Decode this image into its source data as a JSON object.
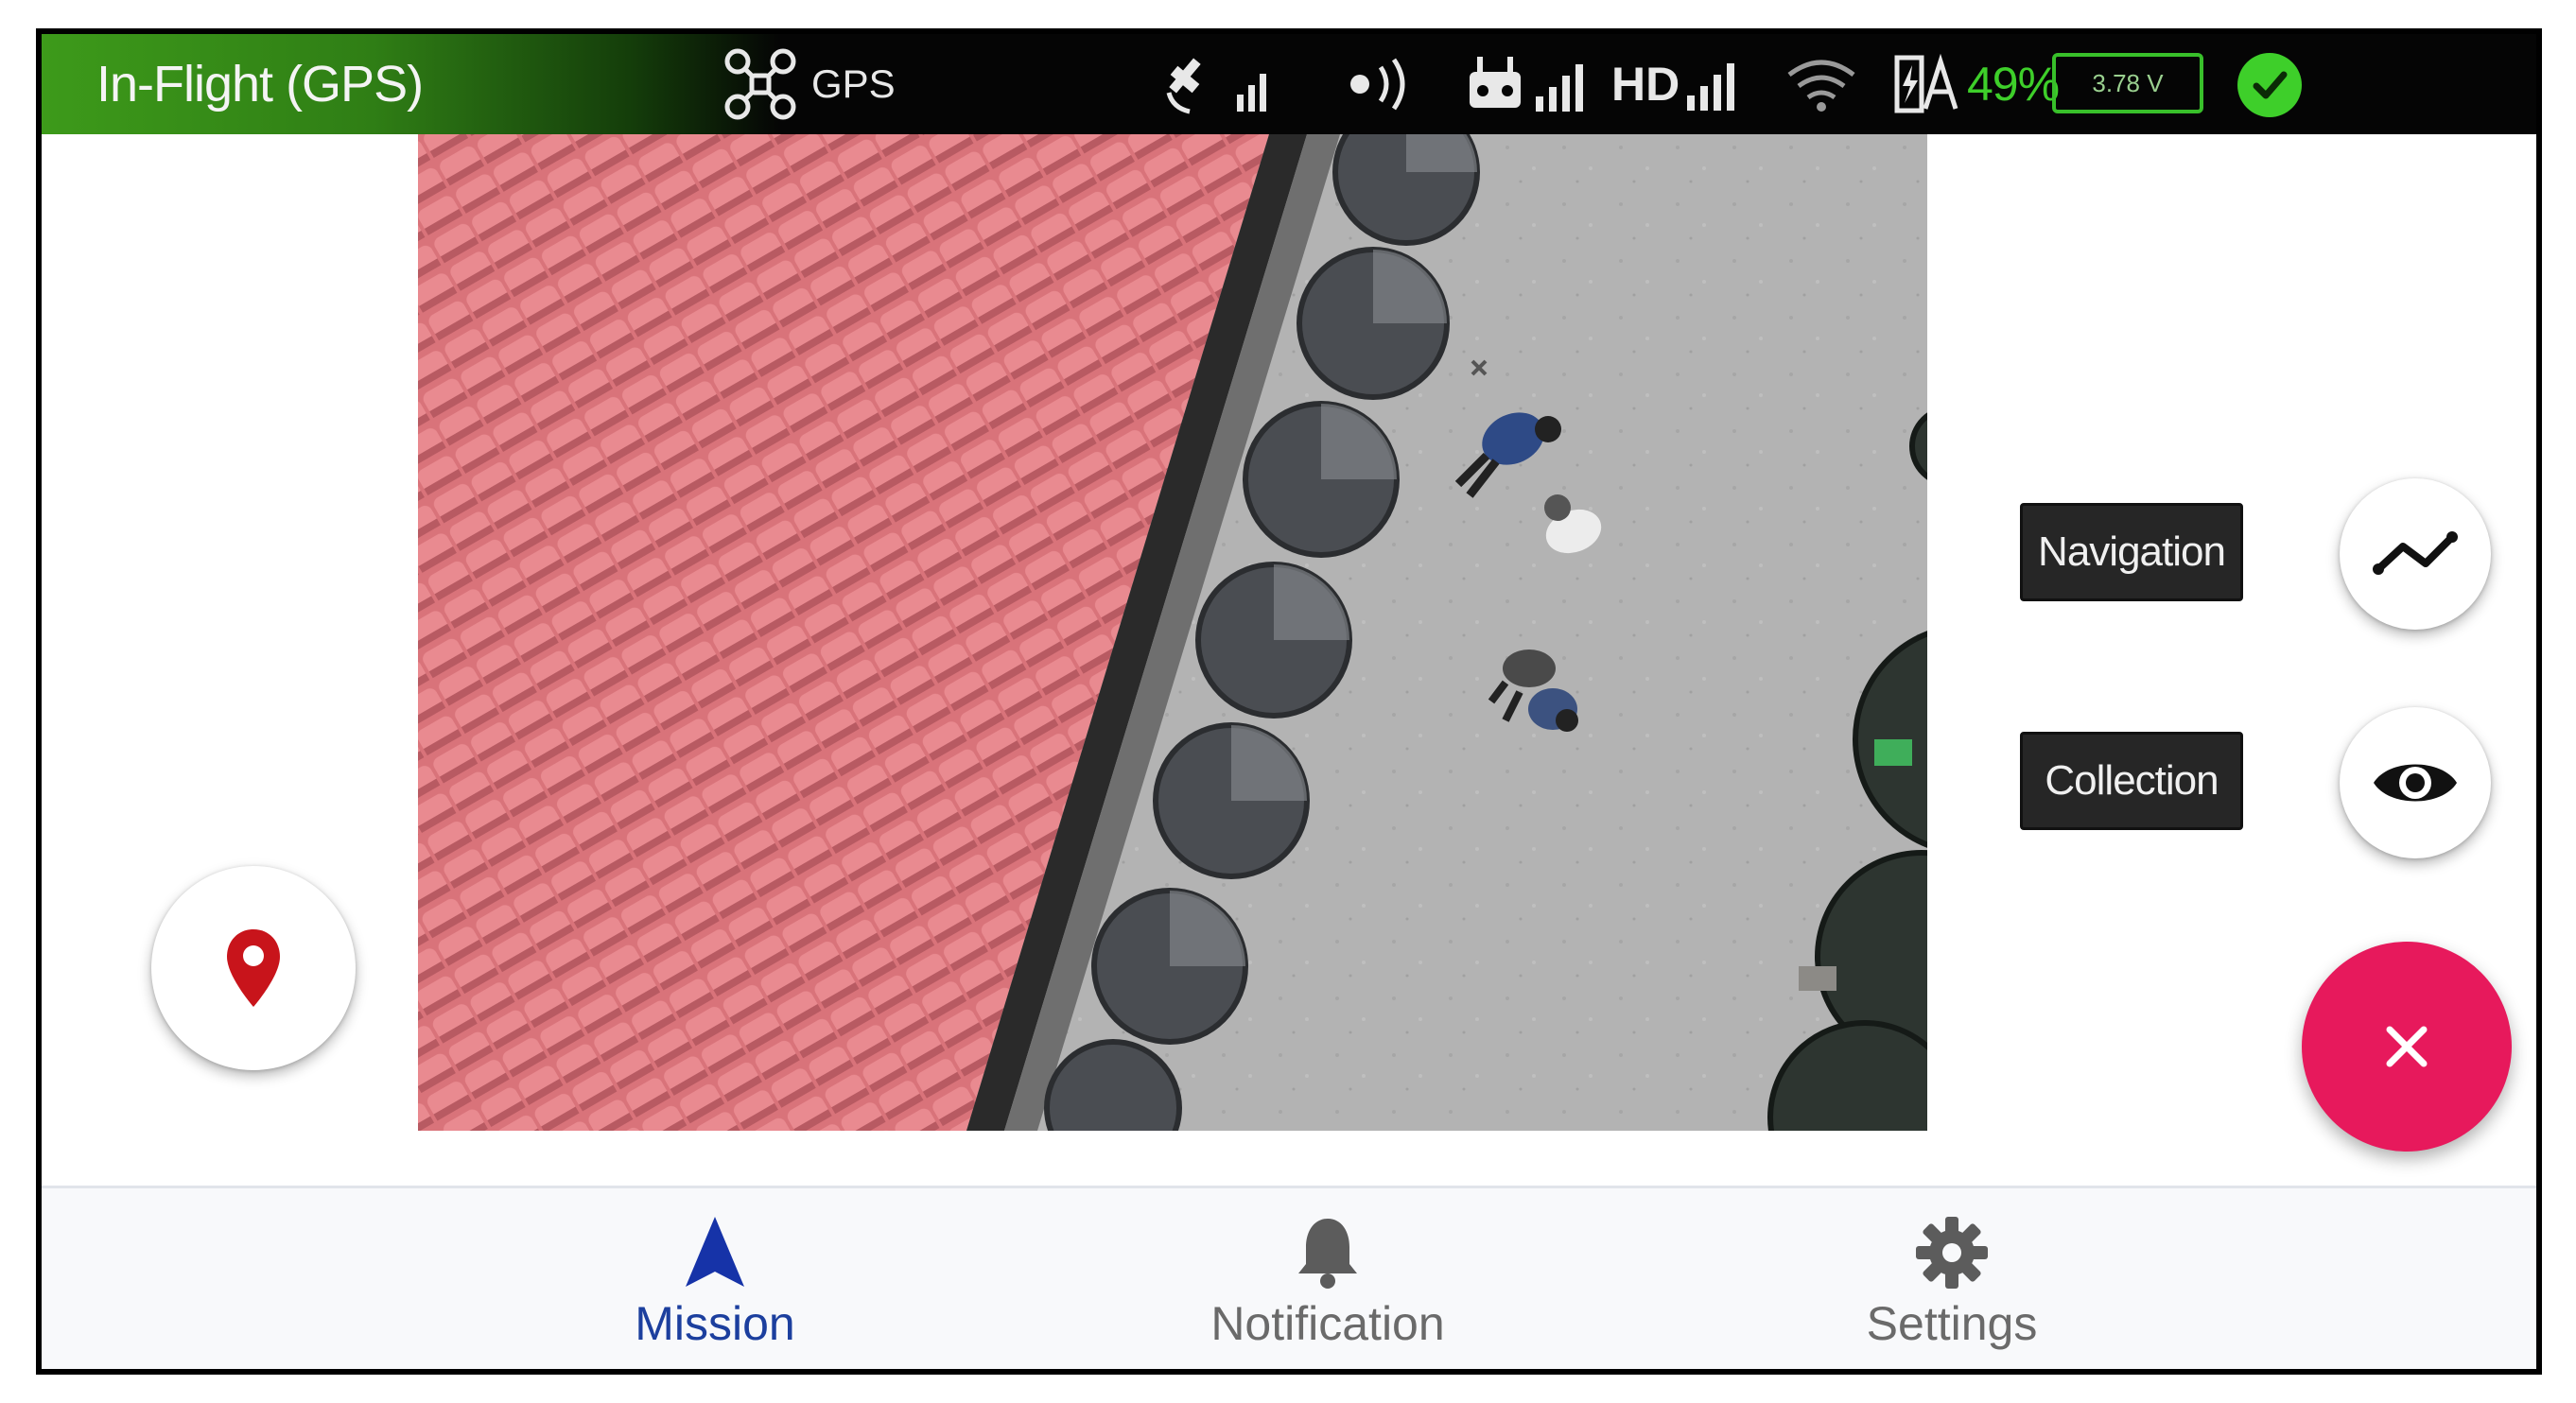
{
  "status_bar": {
    "flight_mode": "In-Flight (GPS)",
    "drone_icon": "drone-icon",
    "gps_label": "GPS",
    "hd_label": "HD",
    "battery_percent": "49%",
    "voltage": "3.78 V",
    "colors": {
      "flight_green": "#3d9a1a",
      "battery_green": "#3ecf2a"
    }
  },
  "camera": {
    "description_icon": "aerial-camera-feed"
  },
  "controls": {
    "navigation_label": "Navigation",
    "collection_label": "Collection",
    "close_color": "#e7195c"
  },
  "bottom_nav": {
    "tabs": [
      {
        "label": "Mission",
        "icon": "navigation-arrow-icon",
        "active": true
      },
      {
        "label": "Notification",
        "icon": "bell-icon",
        "active": false
      },
      {
        "label": "Settings",
        "icon": "gear-icon",
        "active": false
      }
    ],
    "active_color": "#1c3f9e"
  }
}
